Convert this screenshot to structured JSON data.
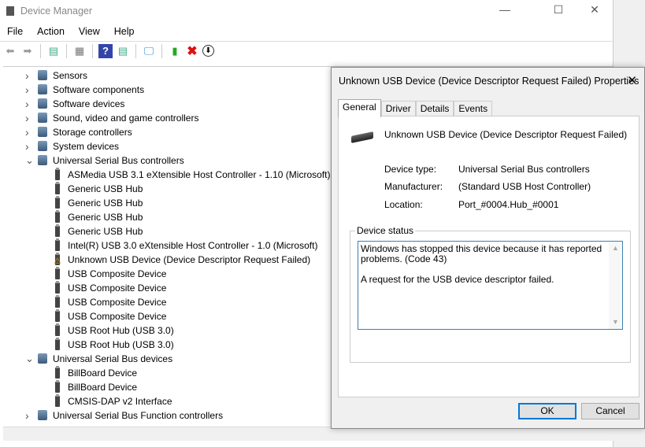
{
  "window": {
    "title": "Device Manager",
    "minimize": "—",
    "maximize": "☐",
    "close": "✕"
  },
  "menu": [
    "File",
    "Action",
    "View",
    "Help"
  ],
  "tree": [
    {
      "label": "Sensors",
      "level": 0,
      "expanded": false
    },
    {
      "label": "Software components",
      "level": 0,
      "expanded": false
    },
    {
      "label": "Software devices",
      "level": 0,
      "expanded": false
    },
    {
      "label": "Sound, video and game controllers",
      "level": 0,
      "expanded": false
    },
    {
      "label": "Storage controllers",
      "level": 0,
      "expanded": false
    },
    {
      "label": "System devices",
      "level": 0,
      "expanded": false
    },
    {
      "label": "Universal Serial Bus controllers",
      "level": 0,
      "expanded": true
    },
    {
      "label": "ASMedia USB 3.1 eXtensible Host Controller - 1.10 (Microsoft)",
      "level": 1
    },
    {
      "label": "Generic USB Hub",
      "level": 1
    },
    {
      "label": "Generic USB Hub",
      "level": 1
    },
    {
      "label": "Generic USB Hub",
      "level": 1
    },
    {
      "label": "Generic USB Hub",
      "level": 1
    },
    {
      "label": "Intel(R) USB 3.0 eXtensible Host Controller - 1.0 (Microsoft)",
      "level": 1
    },
    {
      "label": "Unknown USB Device (Device Descriptor Request Failed)",
      "level": 1,
      "warning": true
    },
    {
      "label": "USB Composite Device",
      "level": 1
    },
    {
      "label": "USB Composite Device",
      "level": 1
    },
    {
      "label": "USB Composite Device",
      "level": 1
    },
    {
      "label": "USB Composite Device",
      "level": 1
    },
    {
      "label": "USB Root Hub (USB 3.0)",
      "level": 1
    },
    {
      "label": "USB Root Hub (USB 3.0)",
      "level": 1
    },
    {
      "label": "Universal Serial Bus devices",
      "level": 0,
      "expanded": true
    },
    {
      "label": "BillBoard Device",
      "level": 1
    },
    {
      "label": "BillBoard Device",
      "level": 1
    },
    {
      "label": "CMSIS-DAP v2 Interface",
      "level": 1
    },
    {
      "label": "Universal Serial Bus Function controllers",
      "level": 0,
      "expanded": false
    }
  ],
  "dialog": {
    "title": "Unknown USB Device (Device Descriptor Request Failed) Properties",
    "close": "✕",
    "tabs": [
      "General",
      "Driver",
      "Details",
      "Events"
    ],
    "device_name": "Unknown USB Device (Device Descriptor Request Failed)",
    "device_type_label": "Device type:",
    "device_type": "Universal Serial Bus controllers",
    "manufacturer_label": "Manufacturer:",
    "manufacturer": "(Standard USB Host Controller)",
    "location_label": "Location:",
    "location": "Port_#0004.Hub_#0001",
    "status_legend": "Device status",
    "status_line1": "Windows has stopped this device because it has reported problems. (Code 43)",
    "status_line2": "A request for the USB device descriptor failed.",
    "ok": "OK",
    "cancel": "Cancel"
  }
}
